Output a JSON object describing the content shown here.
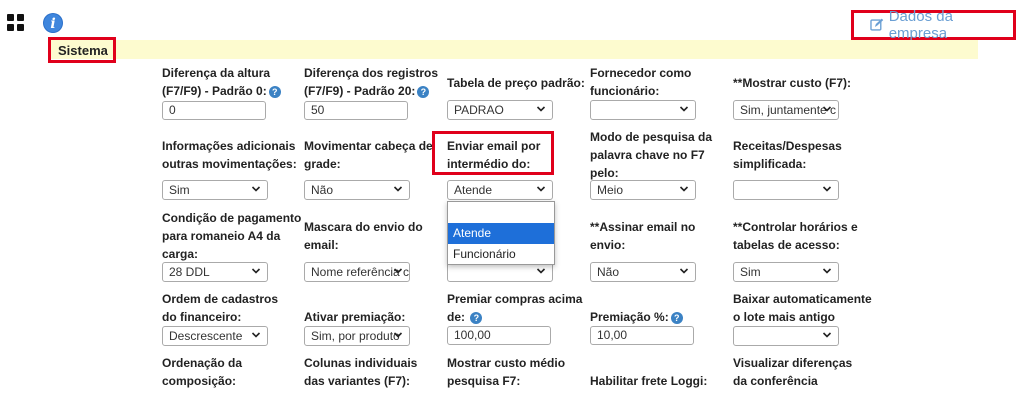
{
  "header": {
    "company_link": "Dados da empresa"
  },
  "section": {
    "title": "Sistema"
  },
  "fields": {
    "f1": {
      "label1": "Diferença da altura",
      "label2": "(F7/F9) - Padrão 0:",
      "value": "0"
    },
    "f2": {
      "label1": "Diferença dos registros",
      "label2": "(F7/F9) - Padrão 20:",
      "value": "50"
    },
    "f3": {
      "label1": "Tabela de preço padrão:",
      "value": "PADRAO"
    },
    "f4": {
      "label1": "Fornecedor como",
      "label2": "funcionário:",
      "value": ""
    },
    "f5": {
      "label1": "**Mostrar custo (F7):",
      "value": "Sim, juntamente c"
    },
    "f6": {
      "label1": "Informações adicionais",
      "label2": "outras movimentações:",
      "value": "Sim"
    },
    "f7": {
      "label1": "Movimentar cabeça de",
      "label2": "grade:",
      "value": "Não"
    },
    "f8": {
      "label1": "Enviar email por",
      "label2": "intermédio do:",
      "value": "Atende"
    },
    "f9": {
      "label1": "Modo de pesquisa da",
      "label2": "palavra chave no F7",
      "label3": "pelo:",
      "value": "Meio"
    },
    "f10": {
      "label1": "Receitas/Despesas",
      "label2": "simplificada:",
      "value": ""
    },
    "f11": {
      "label1": "Condição de pagamento",
      "label2": "para romaneio A4 da",
      "label3": "carga:",
      "value": "28 DDL"
    },
    "f12": {
      "label1": "Mascara do envio do",
      "label2": "email:",
      "value": "Nome referência c"
    },
    "f14": {
      "label1": "**Assinar email no",
      "label2": "envio:",
      "value": "Não"
    },
    "f15": {
      "label1": "**Controlar horários e",
      "label2": "tabelas de acesso:",
      "value": "Sim"
    },
    "f16": {
      "label1": "Ordem de cadastros",
      "label2": "do financeiro:",
      "value": "Descrescente"
    },
    "f17": {
      "label1": "Ativar premiação:",
      "value": "Sim, por produto"
    },
    "f18": {
      "label1": "Premiar compras acima",
      "label2": "de:",
      "value": "100,00"
    },
    "f19": {
      "label1": "Premiação %:",
      "value": "10,00"
    },
    "f20": {
      "label1": "Baixar automaticamente",
      "label2": "o lote mais antigo",
      "value": ""
    },
    "f21": {
      "label1": "Ordenação da",
      "label2": "composição:"
    },
    "f22": {
      "label1": "Colunas individuais",
      "label2": "das variantes (F7):"
    },
    "f23": {
      "label1": "Mostrar custo médio",
      "label2": "pesquisa F7:"
    },
    "f24": {
      "label1": "Habilitar frete Loggi:"
    },
    "f25": {
      "label1": "Visualizar diferenças",
      "label2": "da conferência"
    }
  },
  "dropdown": {
    "options": [
      "",
      "Atende",
      "Funcionário"
    ],
    "selected": "Atende"
  },
  "colors": {
    "accent_red": "#e0001b",
    "link_blue": "#6a9fd4",
    "section_bg": "#fdfbcf",
    "selected_bg": "#1e6fd9"
  }
}
